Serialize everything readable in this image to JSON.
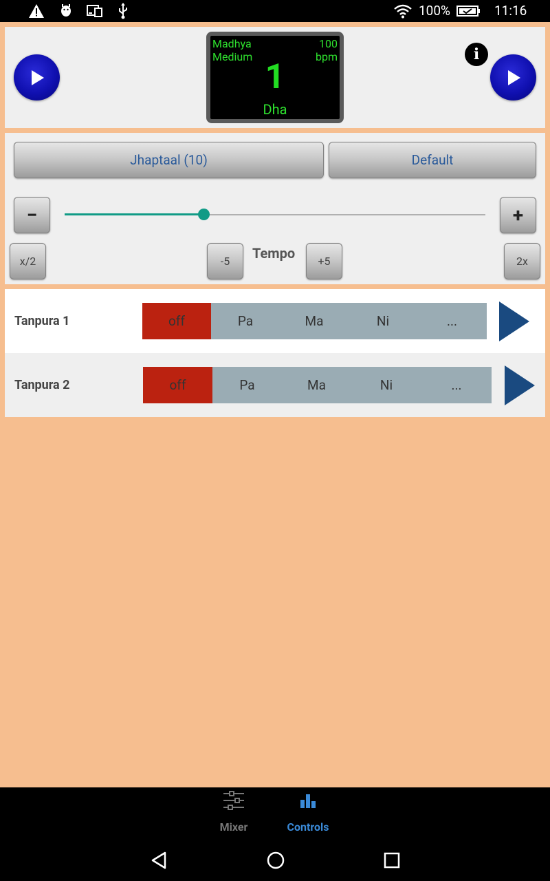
{
  "status_bar": {
    "icons": [
      "warning-icon",
      "android-debug-icon",
      "cast-icon",
      "usb-icon",
      "wifi-icon",
      "battery-icon"
    ],
    "battery": "100%",
    "time": "11:16"
  },
  "display": {
    "laya_name": "Madhya",
    "laya_sub": "Medium",
    "tempo_value": "100",
    "tempo_unit": "bpm",
    "beat_number": "1",
    "bol": "Dha",
    "text_color": "#22dd22"
  },
  "controls": {
    "taal_button": "Jhaptaal (10)",
    "preset_button": "Default",
    "minus_label": "−",
    "plus_label": "+",
    "half_label": "x/2",
    "minus5_label": "-5",
    "tempo_label": "Tempo",
    "plus5_label": "+5",
    "double_label": "2x",
    "slider_fraction": 0.33,
    "accent_color": "#119b86"
  },
  "tanpuras": [
    {
      "label": "Tanpura 1",
      "options": [
        "off",
        "Pa",
        "Ma",
        "Ni",
        "..."
      ],
      "selected": "off"
    },
    {
      "label": "Tanpura 2",
      "options": [
        "off",
        "Pa",
        "Ma",
        "Ni",
        "..."
      ],
      "selected": "off"
    }
  ],
  "tabs": [
    {
      "label": "Mixer",
      "icon": "sliders-icon",
      "active": false
    },
    {
      "label": "Controls",
      "icon": "bar-chart-icon",
      "active": true
    }
  ],
  "nav": {
    "icons": [
      "back-icon",
      "home-icon",
      "recents-icon"
    ]
  },
  "colors": {
    "background": "#f6be8f",
    "selected_segment": "#bb2210",
    "unselected_segment": "#9aacb4",
    "tab_active": "#3a8ad8"
  }
}
